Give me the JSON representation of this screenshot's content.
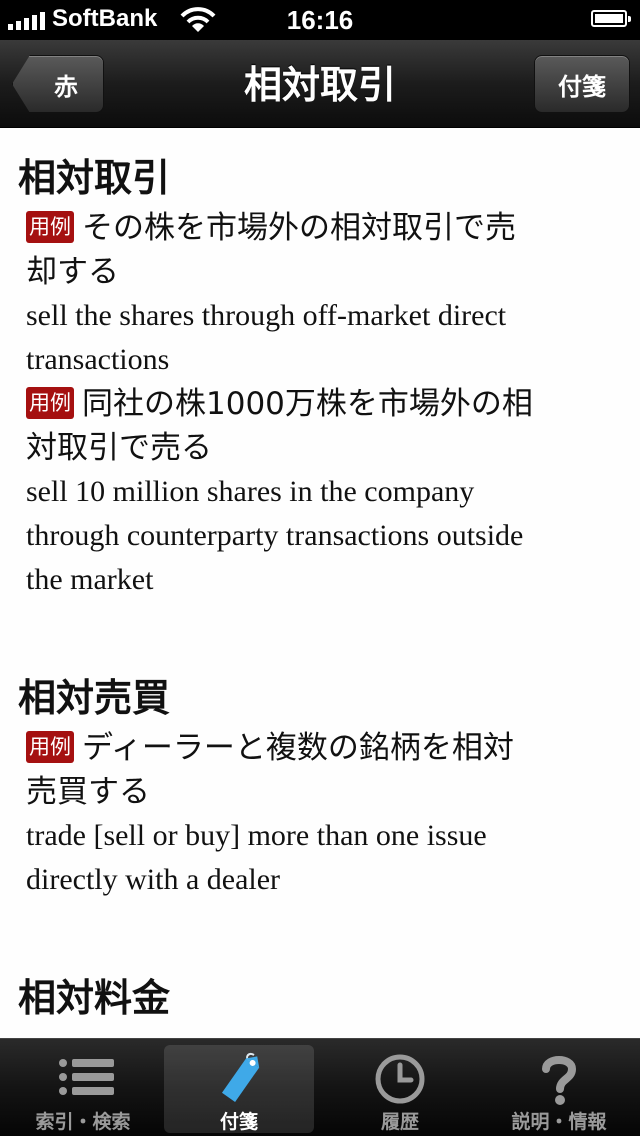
{
  "status": {
    "carrier": "SoftBank",
    "time": "16:16"
  },
  "nav": {
    "back_label": "赤",
    "title": "相対取引",
    "right_label": "付箋"
  },
  "content": {
    "badge_label": "用例",
    "entries": [
      {
        "headword": "相対取引",
        "examples": [
          {
            "jp_lines": [
              "その株を市場外の相対取引で売",
              "却する"
            ],
            "en_lines": [
              "sell the shares through off-market direct",
              "transactions"
            ]
          },
          {
            "jp_lines": [
              "同社の株1000万株を市場外の相",
              "対取引で売る"
            ],
            "en_lines": [
              "sell 10 million shares in the company",
              "through counterparty transactions outside",
              "the market"
            ]
          }
        ]
      },
      {
        "headword": "相対売買",
        "examples": [
          {
            "jp_lines": [
              "ディーラーと複数の銘柄を相対",
              "売買する"
            ],
            "en_lines": [
              "trade [sell or buy] more than one issue",
              "directly with a dealer"
            ]
          }
        ]
      },
      {
        "headword": "相対料金",
        "examples": []
      }
    ]
  },
  "tabs": [
    {
      "label": "索引・検索",
      "icon": "list-icon",
      "selected": false
    },
    {
      "label": "付箋",
      "icon": "tag-icon",
      "selected": true
    },
    {
      "label": "履歴",
      "icon": "clock-icon",
      "selected": false
    },
    {
      "label": "説明・情報",
      "icon": "question-icon",
      "selected": false
    }
  ],
  "colors": {
    "badge": "#a51010",
    "tab_selected_icon": "#3fa9e8"
  }
}
